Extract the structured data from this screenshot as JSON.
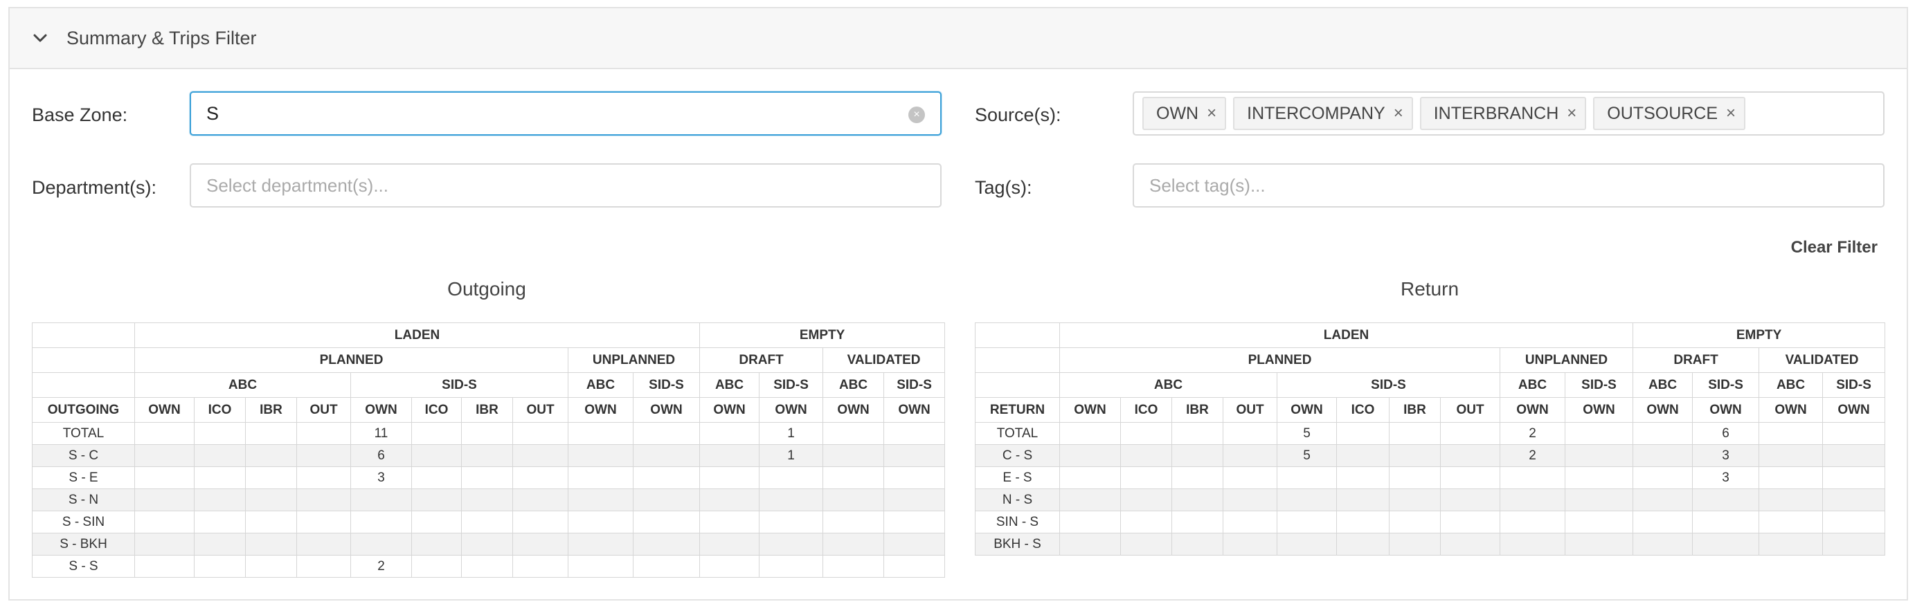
{
  "panel": {
    "title": "Summary & Trips Filter"
  },
  "filters": {
    "base_zone": {
      "label": "Base Zone:",
      "value": "S"
    },
    "department": {
      "label": "Department(s):",
      "placeholder": "Select department(s)..."
    },
    "sources": {
      "label": "Source(s):",
      "tags": [
        "OWN",
        "INTERCOMPANY",
        "INTERBRANCH",
        "OUTSOURCE"
      ]
    },
    "tags": {
      "label": "Tag(s):",
      "placeholder": "Select tag(s)..."
    },
    "clear_label": "Clear Filter"
  },
  "header": {
    "laden": "LADEN",
    "empty": "EMPTY",
    "planned": "PLANNED",
    "unplanned": "UNPLANNED",
    "draft": "DRAFT",
    "validated": "VALIDATED",
    "abc": "ABC",
    "sids": "SID-S",
    "cols": [
      "OWN",
      "ICO",
      "IBR",
      "OUT",
      "OWN",
      "ICO",
      "IBR",
      "OUT",
      "OWN",
      "OWN",
      "OWN",
      "OWN",
      "OWN",
      "OWN"
    ]
  },
  "outgoing": {
    "title": "Outgoing",
    "row_header": "OUTGOING",
    "rows": [
      {
        "label": "TOTAL",
        "values": [
          "",
          "",
          "",
          "",
          "11",
          "",
          "",
          "",
          "",
          "",
          "",
          "1",
          "",
          ""
        ]
      },
      {
        "label": "S - C",
        "values": [
          "",
          "",
          "",
          "",
          "6",
          "",
          "",
          "",
          "",
          "",
          "",
          "1",
          "",
          ""
        ]
      },
      {
        "label": "S - E",
        "values": [
          "",
          "",
          "",
          "",
          "3",
          "",
          "",
          "",
          "",
          "",
          "",
          "",
          "",
          ""
        ]
      },
      {
        "label": "S - N",
        "values": [
          "",
          "",
          "",
          "",
          "",
          "",
          "",
          "",
          "",
          "",
          "",
          "",
          "",
          ""
        ]
      },
      {
        "label": "S - SIN",
        "values": [
          "",
          "",
          "",
          "",
          "",
          "",
          "",
          "",
          "",
          "",
          "",
          "",
          "",
          ""
        ]
      },
      {
        "label": "S - BKH",
        "values": [
          "",
          "",
          "",
          "",
          "",
          "",
          "",
          "",
          "",
          "",
          "",
          "",
          "",
          ""
        ]
      },
      {
        "label": "S - S",
        "values": [
          "",
          "",
          "",
          "",
          "2",
          "",
          "",
          "",
          "",
          "",
          "",
          "",
          "",
          ""
        ]
      }
    ]
  },
  "return": {
    "title": "Return",
    "row_header": "RETURN",
    "rows": [
      {
        "label": "TOTAL",
        "values": [
          "",
          "",
          "",
          "",
          "5",
          "",
          "",
          "",
          "2",
          "",
          "",
          "6",
          "",
          ""
        ]
      },
      {
        "label": "C - S",
        "values": [
          "",
          "",
          "",
          "",
          "5",
          "",
          "",
          "",
          "2",
          "",
          "",
          "3",
          "",
          ""
        ]
      },
      {
        "label": "E - S",
        "values": [
          "",
          "",
          "",
          "",
          "",
          "",
          "",
          "",
          "",
          "",
          "",
          "3",
          "",
          ""
        ]
      },
      {
        "label": "N - S",
        "values": [
          "",
          "",
          "",
          "",
          "",
          "",
          "",
          "",
          "",
          "",
          "",
          "",
          "",
          ""
        ]
      },
      {
        "label": "SIN - S",
        "values": [
          "",
          "",
          "",
          "",
          "",
          "",
          "",
          "",
          "",
          "",
          "",
          "",
          "",
          ""
        ]
      },
      {
        "label": "BKH - S",
        "values": [
          "",
          "",
          "",
          "",
          "",
          "",
          "",
          "",
          "",
          "",
          "",
          "",
          "",
          ""
        ]
      }
    ]
  }
}
